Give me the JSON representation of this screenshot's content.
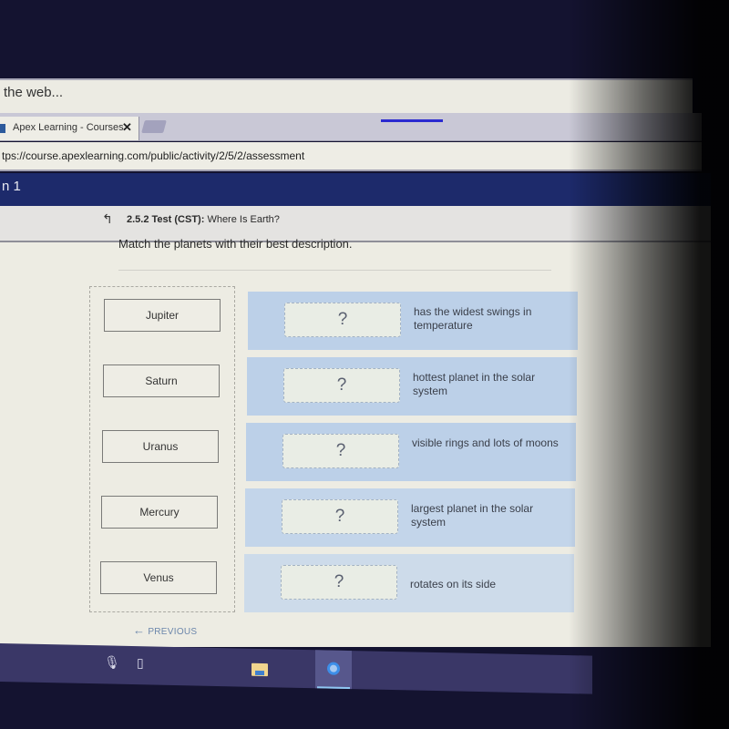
{
  "browser": {
    "search_bar_text": "the web...",
    "tab": {
      "title": "Apex Learning - Courses",
      "close_label": "✕",
      "favicon": "apex-favicon"
    },
    "url": "tps://course.apexlearning.com/public/activity/2/5/2/assessment"
  },
  "app_header": {
    "title_fragment": "n 1"
  },
  "breadcrumb": {
    "back_icon": "↰",
    "section": "2.5.2 Test (CST):",
    "title": "Where Is Earth?"
  },
  "question": {
    "prompt": "Match the planets with their best description.",
    "terms": [
      "Jupiter",
      "Saturn",
      "Uranus",
      "Mercury",
      "Venus"
    ],
    "rows": [
      {
        "slot": "?",
        "description": "has the widest swings in temperature"
      },
      {
        "slot": "?",
        "description": "hottest planet in the solar system"
      },
      {
        "slot": "?",
        "description": "visible rings and lots of moons"
      },
      {
        "slot": "?",
        "description": "largest planet in the solar system"
      },
      {
        "slot": "?",
        "description": "rotates on its side"
      }
    ]
  },
  "navigation": {
    "previous_arrow": "←",
    "previous_label": "PREVIOUS"
  },
  "taskbar": {
    "icons": [
      "microphone-icon",
      "task-view-icon",
      "file-explorer-icon",
      "chrome-icon"
    ],
    "mic_glyph": "🎙",
    "taskview_glyph": "▯"
  }
}
